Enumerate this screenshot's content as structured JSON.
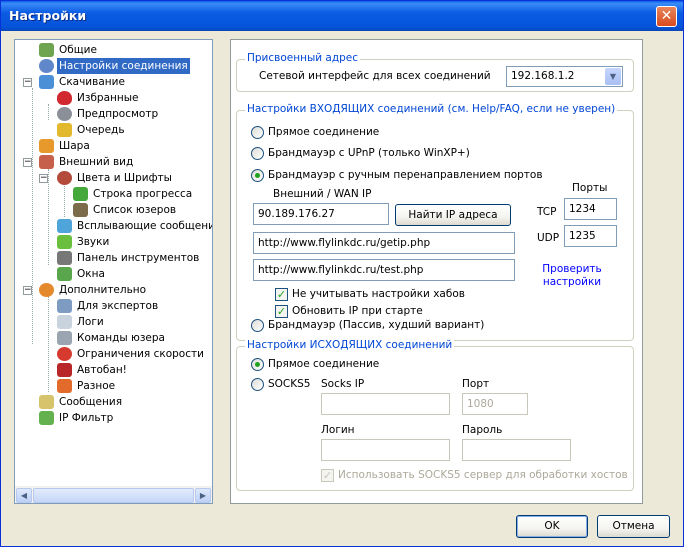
{
  "window": {
    "title": "Настройки",
    "close_glyph": "✕"
  },
  "tree": {
    "items": [
      {
        "label": "Общие",
        "icon": "general-icon"
      },
      {
        "label": "Настройки соединения",
        "icon": "connection-icon",
        "selected": true
      },
      {
        "label": "Скачивание",
        "icon": "download-icon"
      },
      {
        "label": "Избранные",
        "icon": "favorites-heart-icon"
      },
      {
        "label": "Предпросмотр",
        "icon": "preview-icon"
      },
      {
        "label": "Очередь",
        "icon": "queue-icon"
      },
      {
        "label": "Шара",
        "icon": "share-icon"
      },
      {
        "label": "Внешний вид",
        "icon": "appearance-icon"
      },
      {
        "label": "Цвета и Шрифты",
        "icon": "colors-fonts-icon"
      },
      {
        "label": "Строка прогресса",
        "icon": "progress-bar-icon"
      },
      {
        "label": "Список юзеров",
        "icon": "user-list-icon"
      },
      {
        "label": "Всплывающие сообщения",
        "icon": "popup-messages-icon"
      },
      {
        "label": "Звуки",
        "icon": "sounds-icon"
      },
      {
        "label": "Панель инструментов",
        "icon": "toolbar-icon"
      },
      {
        "label": "Окна",
        "icon": "windows-icon"
      },
      {
        "label": "Дополнительно",
        "icon": "advanced-icon"
      },
      {
        "label": "Для экспертов",
        "icon": "experts-icon"
      },
      {
        "label": "Логи",
        "icon": "logs-icon"
      },
      {
        "label": "Команды юзера",
        "icon": "user-commands-icon"
      },
      {
        "label": "Ограничения скорости",
        "icon": "speed-limit-icon"
      },
      {
        "label": "Автобан!",
        "icon": "autoban-icon"
      },
      {
        "label": "Разное",
        "icon": "misc-icon"
      },
      {
        "label": "Сообщения",
        "icon": "messages-icon"
      },
      {
        "label": "IP Фильтр",
        "icon": "ip-filter-icon"
      }
    ],
    "expand_minus": "−",
    "scroll_left": "◀",
    "scroll_right": "▶"
  },
  "assigned": {
    "caption": "Присвоенный адрес",
    "label": "Сетевой интерфейс для всех соединений",
    "value": "192.168.1.2",
    "dropdown_glyph": "▼"
  },
  "incoming": {
    "caption": "Настройки ВХОДЯЩИХ соединений (см. Help/FAQ, если не уверен)",
    "opt_direct": "Прямое соединение",
    "opt_upnp": "Брандмауэр с UPnP (только WinXP+)",
    "opt_manual": "Брандмауэр с ручным перенаправлением портов",
    "wan_label": "Внешний / WAN IP",
    "wan_value": "90.189.176.27",
    "find_ip_button": "Найти IP адреса",
    "ports_label": "Порты",
    "tcp_label": "TCP",
    "tcp_value": "1234",
    "udp_label": "UDP",
    "udp_value": "1235",
    "url1": "http://www.flylinkdc.ru/getip.php",
    "url2": "http://www.flylinkdc.ru/test.php",
    "check_link_line1": "Проверить",
    "check_link_line2": "настройки",
    "chk_ignore_hubs": "Не учитывать настройки хабов",
    "chk_update_ip": "Обновить IP при старте",
    "opt_passive": "Брандмауэр (Пассив, худший вариант)",
    "check_glyph": "✓"
  },
  "outgoing": {
    "caption": "Настройки ИСХОДЯЩИХ соединений",
    "opt_direct": "Прямое соединение",
    "opt_socks5": "SOCKS5",
    "socks_ip_label": "Socks IP",
    "port_label": "Порт",
    "port_value": "1080",
    "login_label": "Логин",
    "password_label": "Пароль",
    "chk_socks_hosts": "Использовать SOCKS5 сервер для обработки хостов"
  },
  "buttons": {
    "ok": "OK",
    "cancel": "Отмена"
  },
  "colors": {
    "title_bar": "#0553d9",
    "selection": "#316ac5",
    "group_caption": "#0046d5",
    "link": "#0000ff",
    "radio_dot": "#21a121"
  }
}
